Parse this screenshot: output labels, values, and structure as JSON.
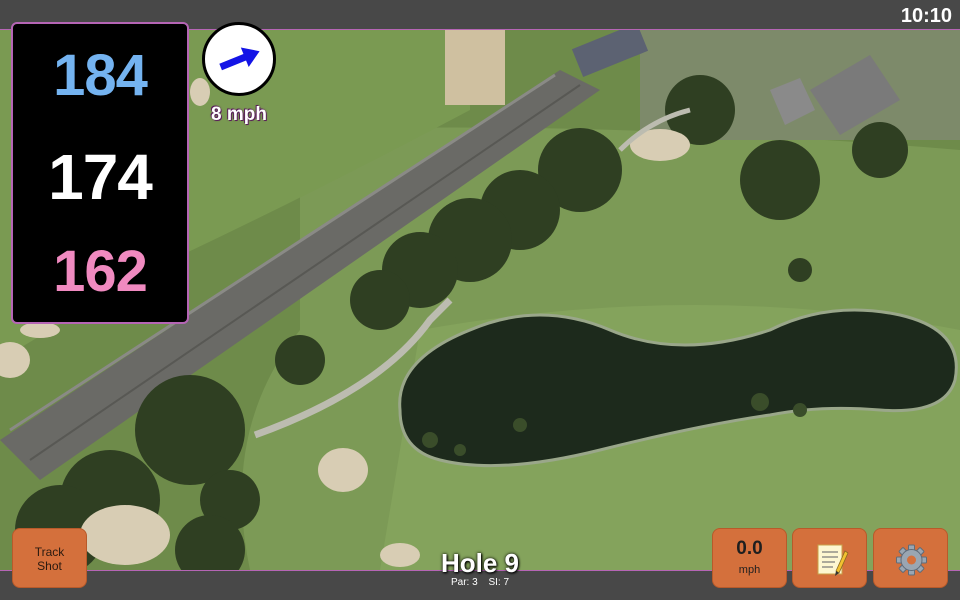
{
  "status_bar": {
    "time": "10:10"
  },
  "distances": {
    "back": "184",
    "center": "174",
    "front": "162"
  },
  "wind": {
    "speed_label": "8 mph",
    "arrow_icon": "wind-arrow-icon"
  },
  "hole": {
    "title": "Hole 9",
    "par": "Par: 3",
    "stroke_index": "SI: 7"
  },
  "buttons": {
    "track_shot": "Track\nShot",
    "speed_value": "0.0",
    "speed_unit": "mph",
    "notes_icon": "notepad-icon",
    "settings_icon": "gear-icon"
  },
  "colors": {
    "back_distance": "#74b3f0",
    "center_distance": "#ffffff",
    "front_distance": "#f08ac0",
    "button": "#d4703c",
    "accent_border": "#b565b5"
  }
}
